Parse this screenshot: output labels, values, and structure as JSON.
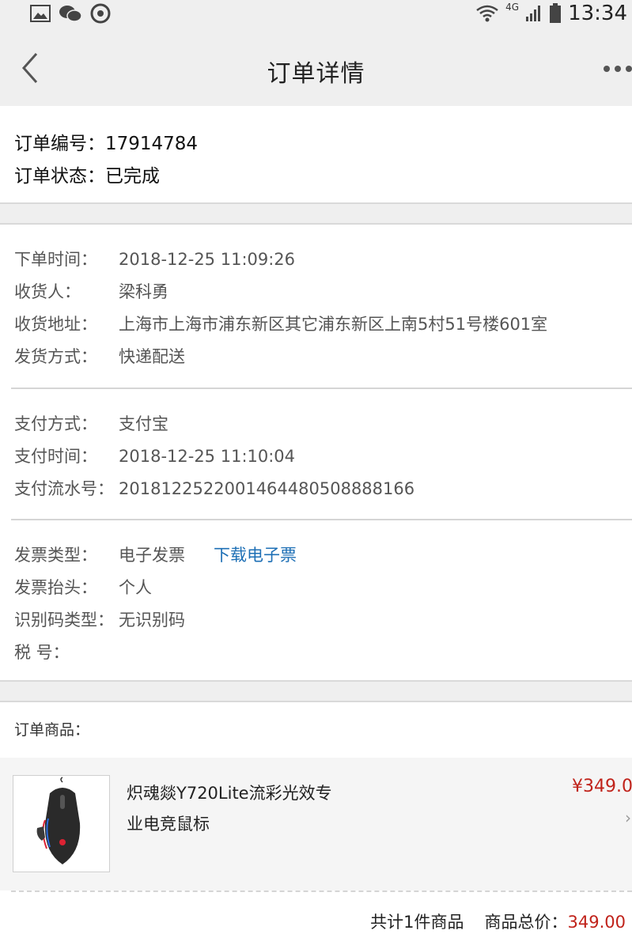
{
  "status_bar": {
    "time": "13:34",
    "network": "4G"
  },
  "nav": {
    "title": "订单详情"
  },
  "order": {
    "number_label": "订单编号：",
    "number": "17914784",
    "status_label": "订单状态：",
    "status": "已完成"
  },
  "delivery": {
    "time_label": "下单时间：",
    "time": "2018-12-25 11:09:26",
    "receiver_label": "收货人：",
    "receiver": "梁科勇",
    "address_label": "收货地址：",
    "address": "上海市上海市浦东新区其它浦东新区上南5村51号楼601室",
    "method_label": "发货方式：",
    "method": "快递配送"
  },
  "payment": {
    "method_label": "支付方式：",
    "method": "支付宝",
    "time_label": "支付时间：",
    "time": "2018-12-25 11:10:04",
    "serial_label": "支付流水号：",
    "serial": "2018122522001464480508888166"
  },
  "invoice": {
    "type_label": "发票类型：",
    "type": "电子发票",
    "download_link": "下载电子票",
    "title_label": "发票抬头：",
    "title": "个人",
    "idtype_label": "识别码类型：",
    "idtype": "无识别码",
    "taxno_label": "税 号：",
    "taxno": ""
  },
  "goods": {
    "label": "订单商品：",
    "items": [
      {
        "name": "炽魂燚Y720Lite流彩光效专业电竞鼠标",
        "price": "¥349.0"
      }
    ],
    "count_text": "共计1件商品",
    "total_label": "商品总价：",
    "total_value": "349.00"
  },
  "colors": {
    "price": "#c0221a",
    "link": "#1d6fb5",
    "background": "#efefef"
  }
}
